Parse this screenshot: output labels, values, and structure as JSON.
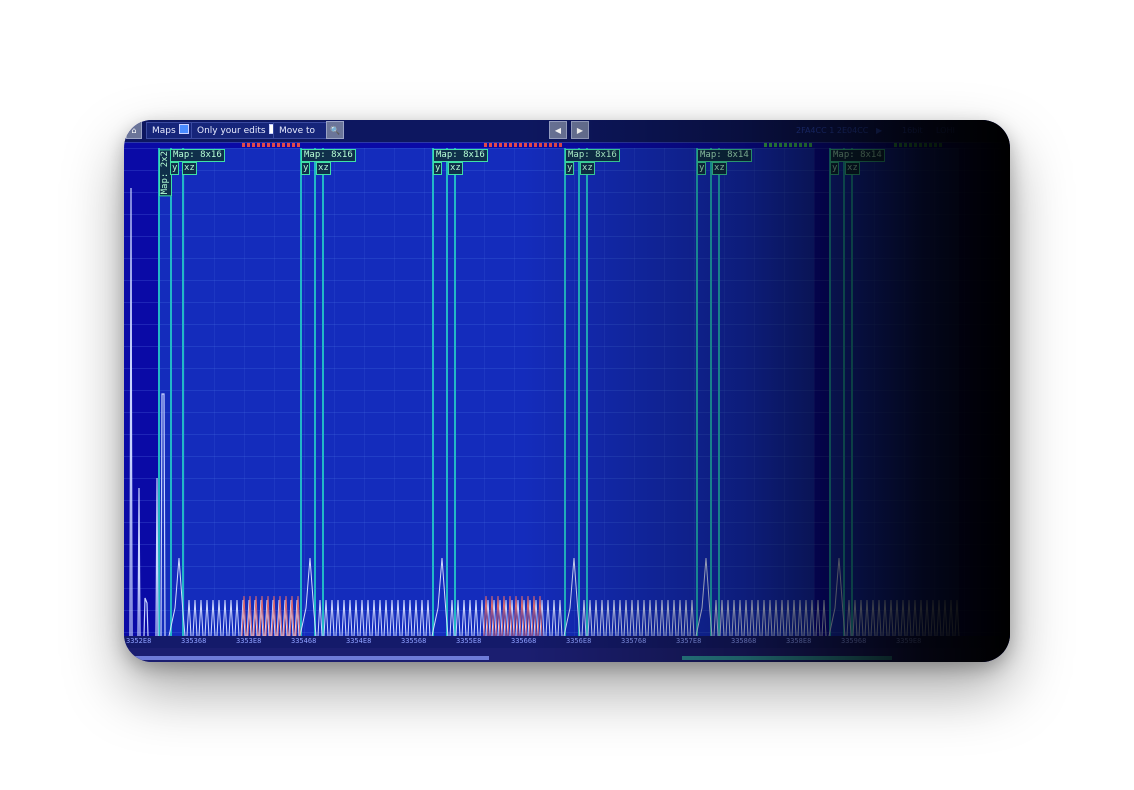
{
  "toolbar": {
    "maps_label": "Maps",
    "only_edits_label": "Only your edits",
    "move_to_label": "Move to",
    "right_text": "2FA4CC 1 2E04CC",
    "right_bits": "16bit",
    "right_endian": "LOHI"
  },
  "maps": [
    {
      "title": "Map: 8x16",
      "y": "y",
      "xz": "xz"
    },
    {
      "title": "Map: 8x16",
      "y": "y",
      "xz": "xz"
    },
    {
      "title": "Map: 8x16",
      "y": "y",
      "xz": "xz"
    },
    {
      "title": "Map: 8x16",
      "y": "y",
      "xz": "xz"
    },
    {
      "title": "Map: 8x14",
      "y": "y",
      "xz": "xz"
    },
    {
      "title": "Map: 8x14",
      "y": "y",
      "xz": "xz"
    }
  ],
  "small_map": {
    "title": "Map: 2x2"
  },
  "axis_ticks": [
    "3352E8",
    "335368",
    "3353E8",
    "335468",
    "3354E8",
    "335568",
    "3355E8",
    "335668",
    "3356E8",
    "335768",
    "3357E8",
    "335868",
    "3358E8",
    "335968",
    "3359E8"
  ],
  "colors": {
    "background": "#0a0aa6",
    "map_fill": "#2a6ee6",
    "map_border": "#22b7c7",
    "label_text": "#b6ffd6"
  }
}
